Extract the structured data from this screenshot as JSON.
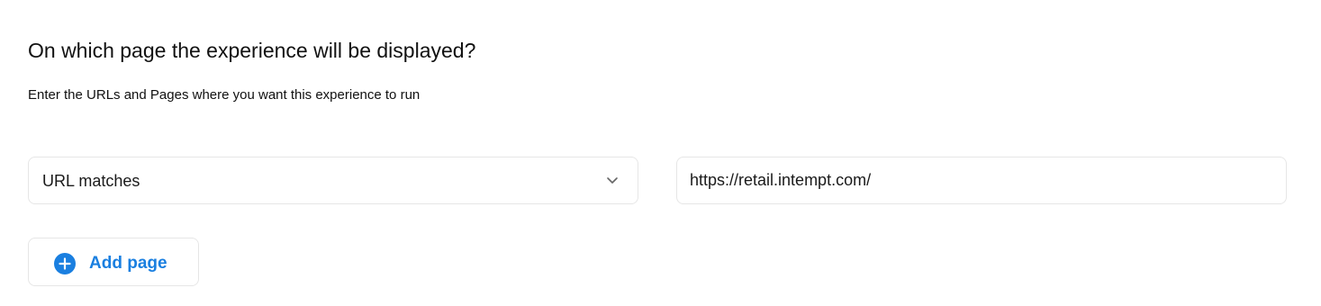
{
  "section": {
    "title": "On which page the experience will be displayed?",
    "subtitle": "Enter the URLs and Pages where you want this experience to run"
  },
  "rule": {
    "match_type": "URL matches",
    "match_type_icon": "chevron-down-icon",
    "url_value": "https://retail.intempt.com/"
  },
  "add_button": {
    "label": "Add page",
    "icon": "plus-circle-icon"
  },
  "colors": {
    "accent": "#1a7fe0",
    "border": "#e6e6e6",
    "text": "#111111"
  }
}
